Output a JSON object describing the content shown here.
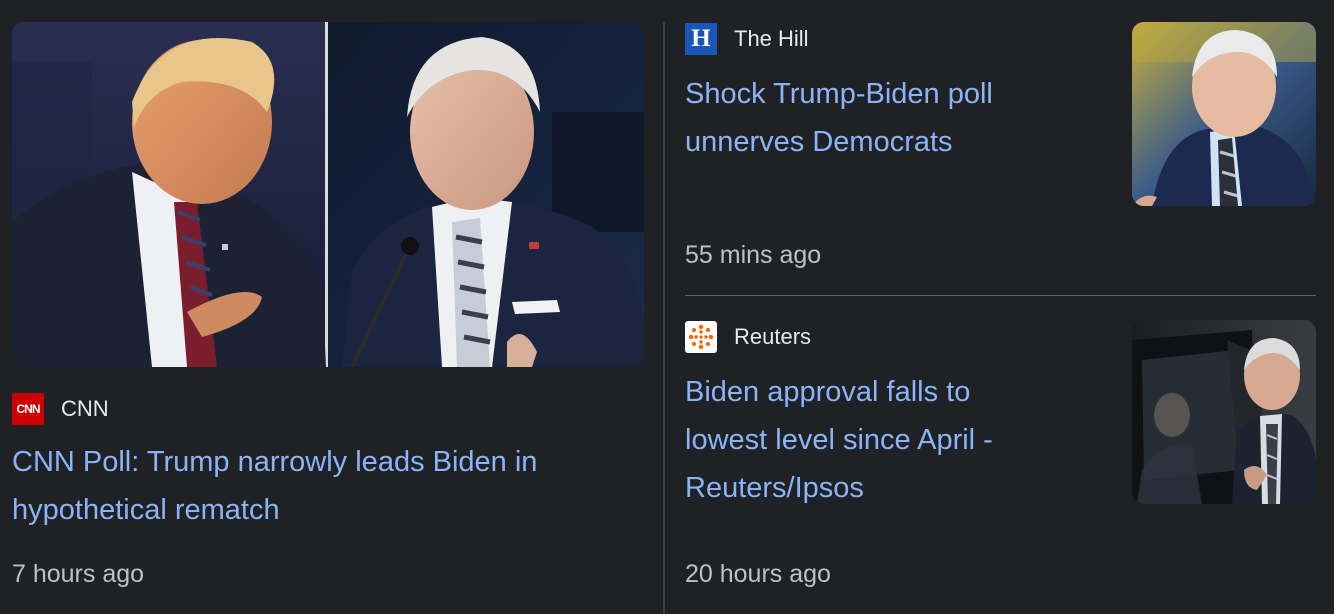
{
  "stories": [
    {
      "source": "CNN",
      "source_logo": "cnn-logo-icon",
      "headline": "CNN Poll: Trump narrowly leads Biden in hypothetical rematch",
      "headline_lines": [
        "CNN Poll: Trump narrowly leads Biden in",
        "hypothetical rematch"
      ],
      "time": "7 hours ago",
      "image": "trump-biden-debate-photo"
    },
    {
      "source": "The Hill",
      "source_logo": "the-hill-logo-icon",
      "headline": "Shock Trump-Biden poll unnerves Democrats",
      "headline_lines": [
        "Shock Trump-Biden poll",
        "unnerves Democrats"
      ],
      "time": "55 mins ago",
      "image": "biden-portrait-photo"
    },
    {
      "source": "Reuters",
      "source_logo": "reuters-logo-icon",
      "headline": "Biden approval falls to lowest level since April - Reuters/Ipsos",
      "headline_lines": [
        "Biden approval falls to",
        "lowest level since April -",
        "Reuters/Ipsos"
      ],
      "time": "20 hours ago",
      "image": "biden-vehicle-photo"
    }
  ],
  "logos": {
    "cnn_text": "CNN",
    "hill_text": "H"
  },
  "colors": {
    "background": "#202124",
    "headline_link": "#8ab4f8",
    "source_text": "#e8eaed",
    "time_text": "#bdc1c6",
    "divider": "#3c4043",
    "cnn_red": "#cc0000",
    "hill_blue": "#1a56b8",
    "reuters_orange": "#fa6400"
  }
}
